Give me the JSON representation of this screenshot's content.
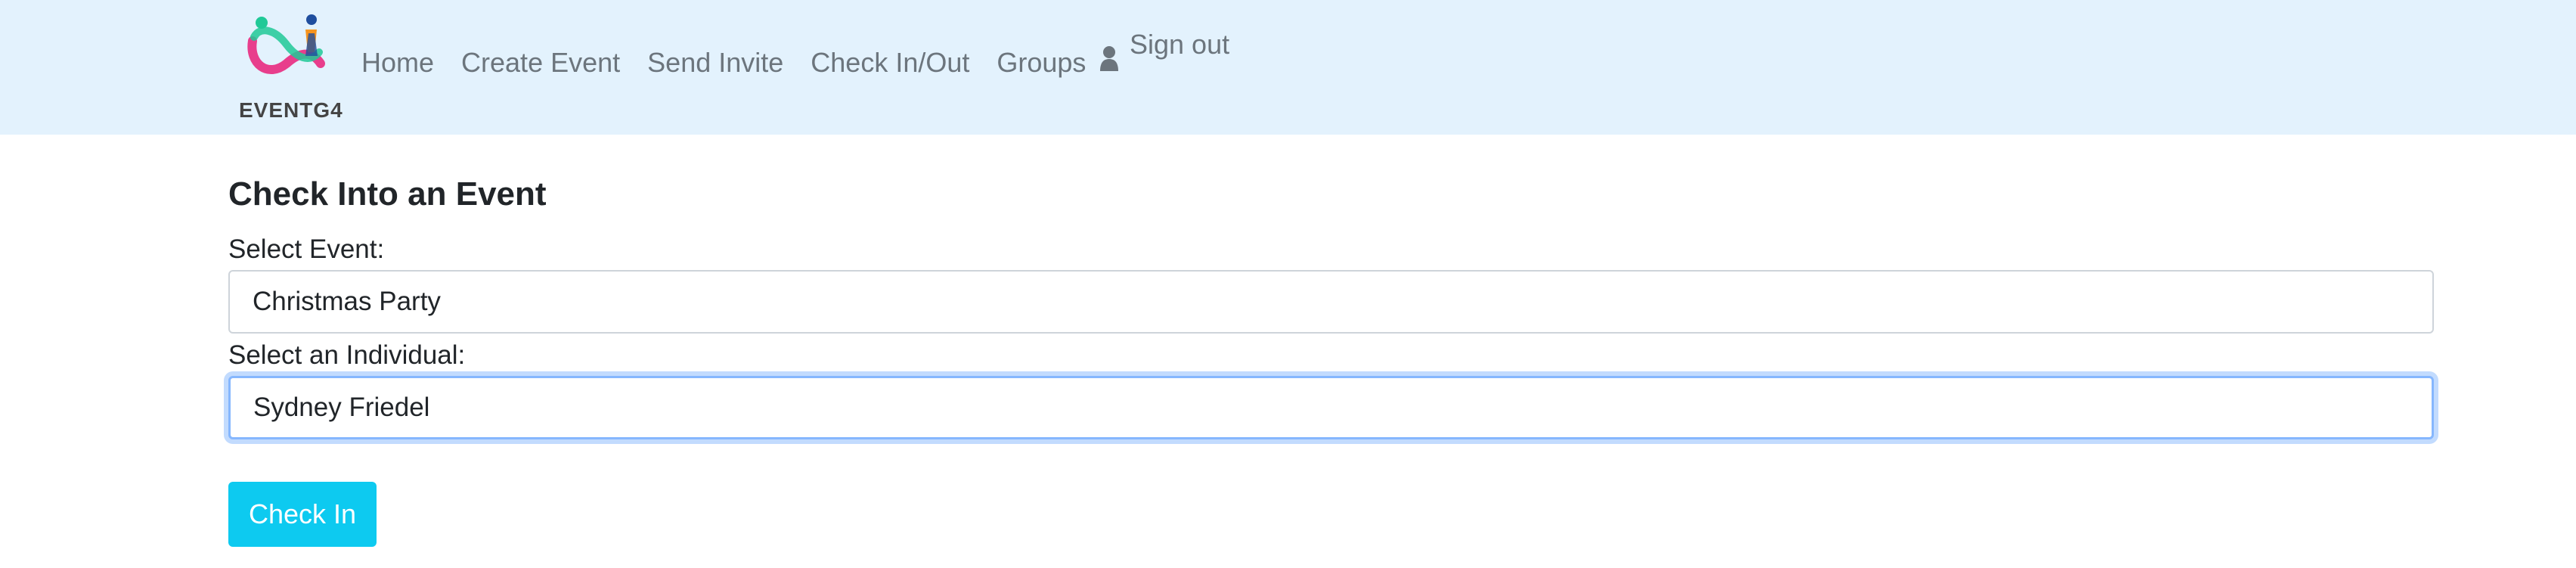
{
  "brand": {
    "name": "EVENTG4",
    "logo_icon": "eventg4-logo-icon"
  },
  "nav": {
    "items": [
      {
        "label": "Home"
      },
      {
        "label": "Create Event"
      },
      {
        "label": "Send Invite"
      },
      {
        "label": "Check In/Out"
      },
      {
        "label": "Groups"
      }
    ],
    "signout": {
      "icon": "user-icon",
      "label": "Sign out"
    }
  },
  "page": {
    "title": "Check Into an Event",
    "event_label": "Select Event:",
    "event_value": "Christmas Party",
    "individual_label": "Select an Individual:",
    "individual_value": "Sydney Friedel",
    "submit_label": "Check In"
  },
  "colors": {
    "navbar_bg": "#e3f2fd",
    "button_bg": "#0dcaf0",
    "focus_ring": "#86b7fe"
  }
}
